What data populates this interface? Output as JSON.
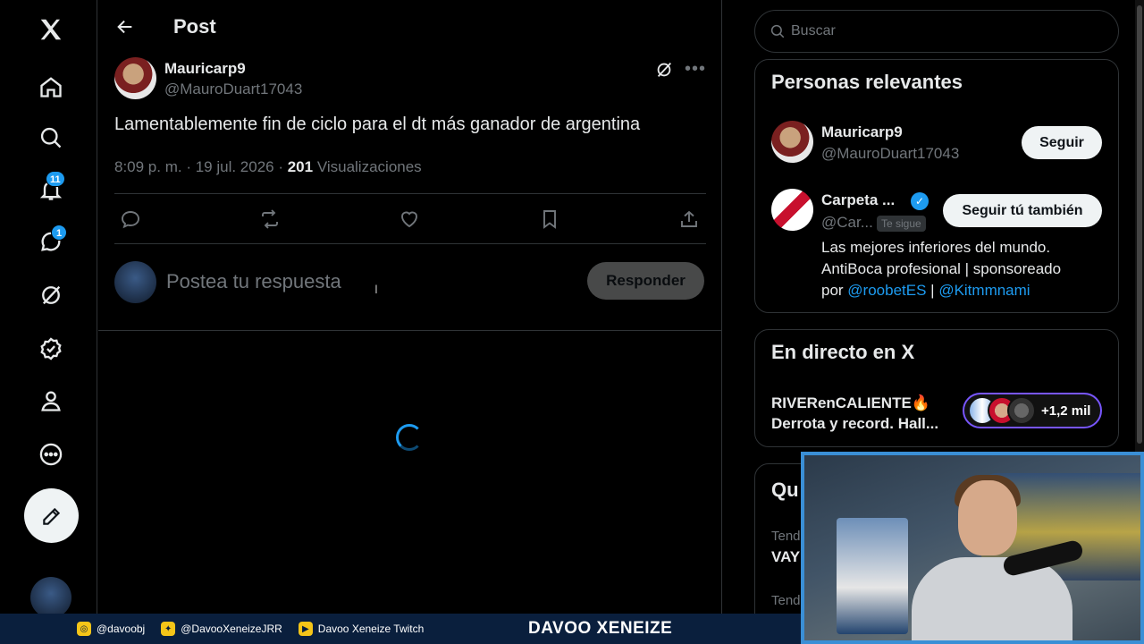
{
  "header": {
    "title": "Post"
  },
  "nav": {
    "notifications_badge": "11",
    "messages_badge": "1"
  },
  "post": {
    "author_name": "Mauricarp9",
    "author_handle": "@MauroDuart17043",
    "text": "Lamentablemente fin de ciclo para el dt más ganador de argentina",
    "time": "8:09 p. m. · 19 jul. 2026 · ",
    "views_count": "201",
    "views_label": " Visualizaciones"
  },
  "reply": {
    "placeholder": "Postea tu respuesta",
    "button_label": "Responder"
  },
  "search": {
    "placeholder": "Buscar"
  },
  "relevant": {
    "title": "Personas relevantes",
    "people": [
      {
        "name": "Mauricarp9",
        "handle": "@MauroDuart17043",
        "button": "Seguir"
      },
      {
        "name": "Carpeta ...",
        "handle": "@Car...",
        "follows_you": "Te sigue",
        "button": "Seguir tú también",
        "bio_line1": "Las mejores inferiores del mundo.",
        "bio_line2": "AntiBoca profesional | sponsoreado",
        "bio_line3_prefix": "por ",
        "bio_link1": "@roobetES",
        "bio_sep": " | ",
        "bio_link2": "@Kitmmnami"
      }
    ]
  },
  "live": {
    "title": "En directo en X",
    "host": "RIVERenCALIENTE🔥",
    "subtitle": "Derrota y record. Hall...",
    "count": "+1,2 mil"
  },
  "third_card": {
    "title_partial": "Qu",
    "line1": "Tend",
    "line2": "VAY",
    "line3": "Tend"
  },
  "banner": {
    "instagram": "@davoobj",
    "twitter": "@DavooXeneizeJRR",
    "twitch": "Davoo Xeneize Twitch",
    "brand": "DAVOO XENEIZE"
  },
  "colors": {
    "accent": "#1d9bf0",
    "live_border": "#7856ff",
    "banner_bg": "#0a1f3d",
    "webcam_border": "#3a8fd6"
  }
}
